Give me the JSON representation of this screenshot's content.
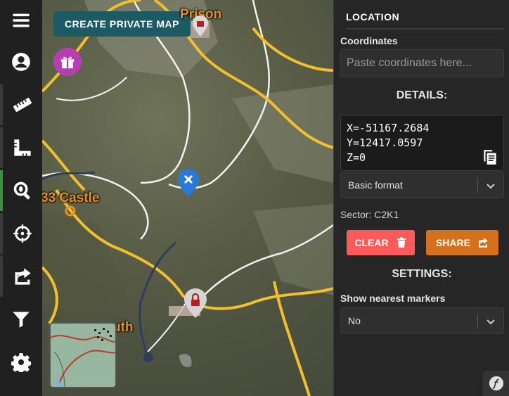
{
  "toolbar": {
    "items": [
      {
        "icon": "menu-icon"
      },
      {
        "icon": "user-circle-icon"
      },
      {
        "icon": "ruler-icon"
      },
      {
        "icon": "ruler-combined-icon"
      },
      {
        "icon": "search-location-icon"
      },
      {
        "icon": "crosshairs-icon"
      },
      {
        "icon": "share-square-icon"
      },
      {
        "icon": "filter-icon"
      },
      {
        "icon": "cog-icon"
      }
    ]
  },
  "map": {
    "create_button": "CREATE PRIVATE MAP",
    "labels": {
      "prison": "Prison",
      "castle": "33 Castle",
      "south": "uth"
    }
  },
  "panel": {
    "title": "LOCATION",
    "coordinates_label": "Coordinates",
    "coordinates_placeholder": "Paste coordinates here...",
    "details_heading": "DETAILS:",
    "details": {
      "x": "X=-51167.2684",
      "y": "Y=12417.0597",
      "z": "Z=0"
    },
    "format_select": "Basic format",
    "sector": "Sector: C2K1",
    "clear_button": "CLEAR",
    "share_button": "SHARE",
    "settings_heading": "SETTINGS:",
    "nearest_label": "Show nearest markers",
    "nearest_select": "No"
  },
  "colors": {
    "accent_orange": "#e88f1f",
    "clear_red": "#ff5a5a",
    "share_orange": "#d5711c",
    "create_teal": "#1c5b63",
    "active_green": "#3e8e41"
  }
}
